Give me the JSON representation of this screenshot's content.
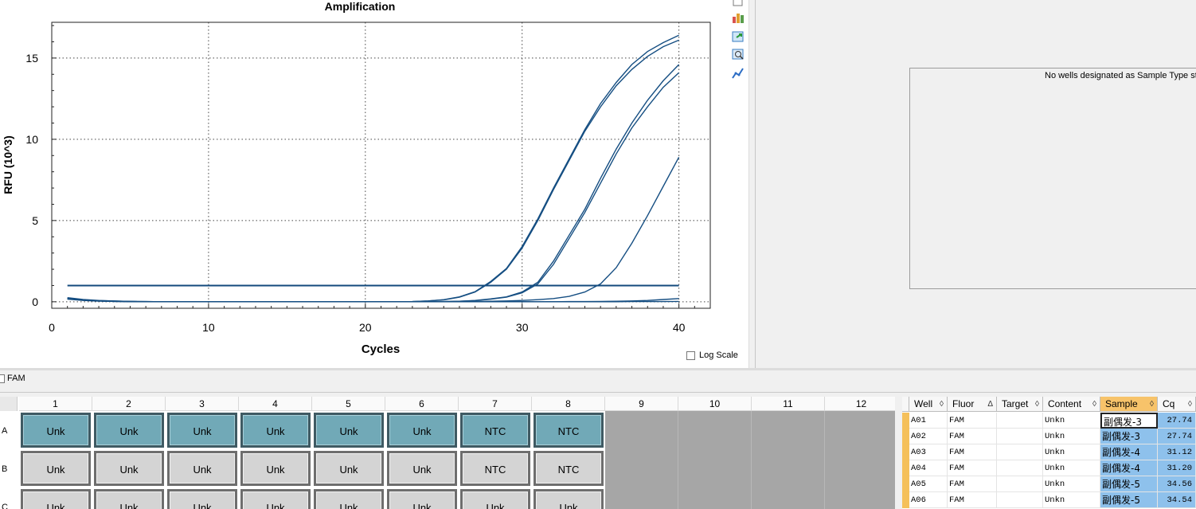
{
  "chart_data": {
    "type": "line",
    "title": "Amplification",
    "xlabel": "Cycles",
    "ylabel": "RFU (10^3)",
    "xlim": [
      0,
      42
    ],
    "ylim": [
      -0.4,
      17.2
    ],
    "xticks": [
      0,
      10,
      20,
      30,
      40
    ],
    "yticks": [
      0,
      5,
      10,
      15
    ],
    "grid": true,
    "threshold": 1.0,
    "x": [
      1,
      2,
      3,
      4,
      5,
      6,
      7,
      8,
      9,
      10,
      11,
      12,
      13,
      14,
      15,
      16,
      17,
      18,
      19,
      20,
      21,
      22,
      23,
      24,
      25,
      26,
      27,
      28,
      29,
      30,
      31,
      32,
      33,
      34,
      35,
      36,
      37,
      38,
      39,
      40
    ],
    "series": [
      {
        "values": [
          0.2,
          0.12,
          0.07,
          0.04,
          0.02,
          0.01,
          0,
          0,
          0,
          0,
          0,
          0,
          0,
          0,
          0,
          0,
          0,
          0,
          0,
          0,
          0,
          0,
          0.01,
          0.05,
          0.12,
          0.28,
          0.6,
          1.2,
          2.0,
          3.3,
          5.0,
          6.9,
          8.7,
          10.5,
          12.0,
          13.3,
          14.3,
          15.1,
          15.7,
          16.1
        ]
      },
      {
        "values": [
          0.25,
          0.14,
          0.08,
          0.05,
          0.02,
          0.01,
          0,
          0,
          0,
          0,
          0,
          0,
          0,
          0,
          0,
          0,
          0,
          0,
          0,
          0,
          0,
          0,
          0.01,
          0.05,
          0.13,
          0.3,
          0.62,
          1.25,
          2.05,
          3.4,
          5.1,
          7.0,
          8.8,
          10.6,
          12.2,
          13.5,
          14.6,
          15.4,
          15.95,
          16.4
        ]
      },
      {
        "values": [
          0.22,
          0.12,
          0.06,
          0.03,
          0.01,
          0,
          0,
          0,
          0,
          0,
          0,
          0,
          0,
          0,
          0,
          0,
          0,
          0,
          0,
          0,
          0,
          0,
          0,
          0,
          0.01,
          0.03,
          0.08,
          0.18,
          0.3,
          0.6,
          1.2,
          2.5,
          4.1,
          5.7,
          7.6,
          9.4,
          11.0,
          12.4,
          13.6,
          14.6
        ]
      },
      {
        "values": [
          0.2,
          0.11,
          0.06,
          0.03,
          0.01,
          0,
          0,
          0,
          0,
          0,
          0,
          0,
          0,
          0,
          0,
          0,
          0,
          0,
          0,
          0,
          0,
          0,
          0,
          0,
          0.01,
          0.03,
          0.07,
          0.16,
          0.28,
          0.55,
          1.1,
          2.3,
          3.9,
          5.5,
          7.3,
          9.1,
          10.7,
          12.0,
          13.2,
          14.1
        ]
      },
      {
        "values": [
          0.2,
          0.1,
          0.05,
          0.02,
          0.01,
          0,
          0,
          0,
          0,
          0,
          0,
          0,
          0,
          0,
          0,
          0,
          0,
          0,
          0,
          0,
          0,
          0,
          0,
          0,
          0,
          0,
          0.01,
          0.03,
          0.05,
          0.08,
          0.13,
          0.2,
          0.33,
          0.6,
          1.1,
          2.1,
          3.6,
          5.3,
          7.1,
          8.9
        ]
      },
      {
        "values": [
          0.18,
          0.1,
          0.05,
          0.02,
          0.01,
          0,
          0,
          0,
          0,
          0,
          0,
          0,
          0,
          0,
          0,
          0,
          0,
          0,
          0,
          0,
          0,
          0,
          0,
          0,
          0,
          0,
          0,
          0,
          0,
          0,
          0,
          0,
          0.01,
          0.01,
          0.02,
          0.03,
          0.05,
          0.08,
          0.14,
          0.2
        ]
      },
      {
        "values": [
          0.16,
          0.08,
          0.04,
          0.02,
          0.01,
          0,
          0,
          0,
          0,
          0,
          0,
          0,
          0,
          0,
          0,
          0,
          0,
          0,
          0,
          0,
          0,
          0,
          0,
          0,
          0,
          0,
          0,
          0,
          0,
          0,
          0,
          0,
          0,
          0,
          0,
          0,
          0.01,
          0.01,
          0.01,
          0.02
        ]
      }
    ]
  },
  "log_scale_label": "Log Scale",
  "no_std_message": "No wells designated as Sample Type sta",
  "fluor_label": "FAM",
  "plate": {
    "columns": [
      "1",
      "2",
      "3",
      "4",
      "5",
      "6",
      "7",
      "8",
      "9",
      "10",
      "11",
      "12"
    ],
    "rows": [
      {
        "label": "A",
        "wells": [
          "Unk",
          "Unk",
          "Unk",
          "Unk",
          "Unk",
          "Unk",
          "NTC",
          "NTC"
        ]
      },
      {
        "label": "B",
        "wells": [
          "Unk",
          "Unk",
          "Unk",
          "Unk",
          "Unk",
          "Unk",
          "NTC",
          "NTC"
        ]
      },
      {
        "label": "C",
        "wells": [
          "Unk",
          "Unk",
          "Unk",
          "Unk",
          "Unk",
          "Unk",
          "Unk",
          "Unk"
        ]
      }
    ]
  },
  "table": {
    "headers": [
      "Well",
      "Fluor",
      "Target",
      "Content",
      "Sample",
      "Cq"
    ],
    "rows": [
      {
        "well": "A01",
        "fluor": "FAM",
        "target": "",
        "content": "Unkn",
        "sample": "副偶发-3",
        "cq": "27.74"
      },
      {
        "well": "A02",
        "fluor": "FAM",
        "target": "",
        "content": "Unkn",
        "sample": "副偶发-3",
        "cq": "27.74"
      },
      {
        "well": "A03",
        "fluor": "FAM",
        "target": "",
        "content": "Unkn",
        "sample": "副偶发-4",
        "cq": "31.12"
      },
      {
        "well": "A04",
        "fluor": "FAM",
        "target": "",
        "content": "Unkn",
        "sample": "副偶发-4",
        "cq": "31.20"
      },
      {
        "well": "A05",
        "fluor": "FAM",
        "target": "",
        "content": "Unkn",
        "sample": "副偶发-5",
        "cq": "34.56"
      },
      {
        "well": "A06",
        "fluor": "FAM",
        "target": "",
        "content": "Unkn",
        "sample": "副偶发-5",
        "cq": "34.54"
      }
    ]
  }
}
